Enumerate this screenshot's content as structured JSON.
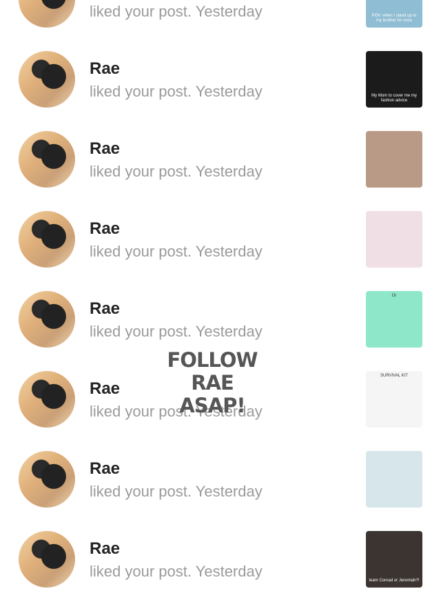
{
  "notifications": [
    {
      "name": "",
      "action": "liked your post.",
      "time": "Yesterday",
      "thumb_color": "#8fbdd3",
      "thumb_text": "POV: when I stand up to my brother for once"
    },
    {
      "name": "Rae",
      "action": "liked your post.",
      "time": "Yesterday",
      "thumb_color": "#1b1b1b",
      "thumb_text": "My Mom to cover me my fashion advice"
    },
    {
      "name": "Rae",
      "action": "liked your post.",
      "time": "Yesterday",
      "thumb_color": "#b89a86",
      "thumb_text": ""
    },
    {
      "name": "Rae",
      "action": "liked your post.",
      "time": "Yesterday",
      "thumb_color": "#f1dfe6",
      "thumb_text": ""
    },
    {
      "name": "Rae",
      "action": "liked your post.",
      "time": "Yesterday",
      "thumb_color": "#8fe7c9",
      "thumb_text": "Or"
    },
    {
      "name": "Rae",
      "action": "liked your post.",
      "time": "Yesterday",
      "thumb_color": "#f5f5f5",
      "thumb_text": "SURVIVAL KIT"
    },
    {
      "name": "Rae",
      "action": "liked your post.",
      "time": "Yesterday",
      "thumb_color": "#d6e6ea",
      "thumb_text": ""
    },
    {
      "name": "Rae",
      "action": "liked your post.",
      "time": "Yesterday",
      "thumb_color": "#3b3430",
      "thumb_text": "team Conrad or Jeremiah?!"
    }
  ],
  "overlay": {
    "line1": "FOLLOW RAE",
    "line2": "ASAP!"
  }
}
